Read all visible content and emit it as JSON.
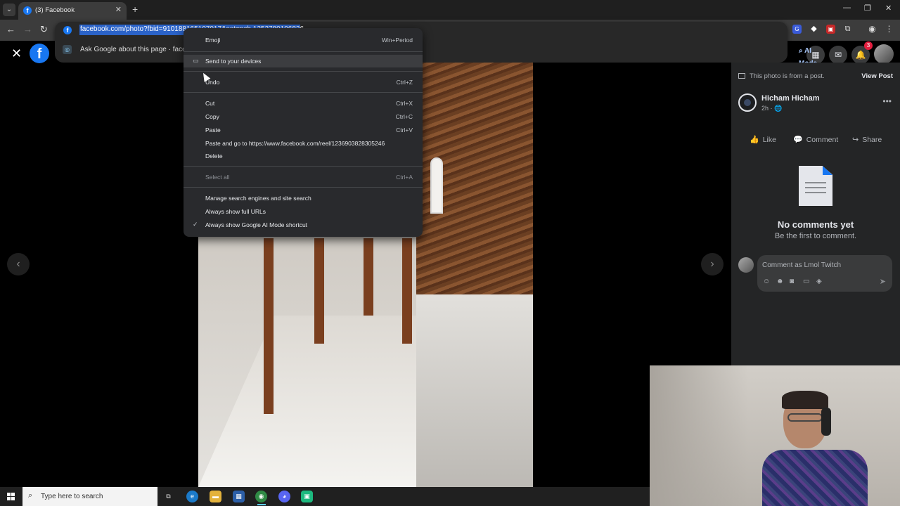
{
  "browser": {
    "tab_title": "(3) Facebook",
    "tab_favicon_letter": "f",
    "address_url": "facebook.com/photo?fbid=910188165107017&set=pcb.1252780106836",
    "ask_google_text": "Ask Google about this page · faceb",
    "ai_mode_label": "AI Mode",
    "icons": [
      "back-icon",
      "forward-icon",
      "reload-icon",
      "tab-search-icon",
      "new-tab-icon",
      "minimize-icon",
      "restore-icon",
      "close-window-icon",
      "translate-icon",
      "extensions-icon",
      "profile-icon",
      "menu-icon"
    ]
  },
  "context_menu": {
    "items": [
      {
        "label": "Emoji",
        "shortcut": "Win+Period"
      },
      {
        "label": "Send to your devices",
        "shortcut": ""
      },
      {
        "label": "Undo",
        "shortcut": "Ctrl+Z"
      },
      {
        "label": "Cut",
        "shortcut": "Ctrl+X"
      },
      {
        "label": "Copy",
        "shortcut": "Ctrl+C"
      },
      {
        "label": "Paste",
        "shortcut": "Ctrl+V"
      },
      {
        "label": "Paste and go to https://www.facebook.com/reel/1236903828305246",
        "shortcut": ""
      },
      {
        "label": "Delete",
        "shortcut": ""
      },
      {
        "label": "Select all",
        "shortcut": "Ctrl+A"
      },
      {
        "label": "Manage search engines and site search",
        "shortcut": ""
      },
      {
        "label": "Always show full URLs",
        "shortcut": ""
      },
      {
        "label": "Always show Google AI Mode shortcut",
        "shortcut": ""
      }
    ],
    "checked_item": "Always show Google AI Mode shortcut",
    "disabled_item": "Select all"
  },
  "facebook": {
    "notification_count": "3",
    "panel": {
      "from_post_text": "This photo is from a post.",
      "view_post_label": "View Post",
      "author_name": "Hicham Hicham",
      "post_time": "2h ·",
      "like_label": "Like",
      "comment_label": "Comment",
      "share_label": "Share",
      "no_comments_title": "No comments yet",
      "no_comments_sub": "Be the first to comment.",
      "comment_placeholder": "Comment as Lmol Twitch"
    }
  },
  "taskbar": {
    "search_placeholder": "Type here to search"
  },
  "colors": {
    "facebook_blue": "#1877f2",
    "url_selection": "#2b63c8",
    "menu_bg": "#292a2d",
    "panel_bg": "#242526",
    "notification_red": "#e41e3f"
  }
}
